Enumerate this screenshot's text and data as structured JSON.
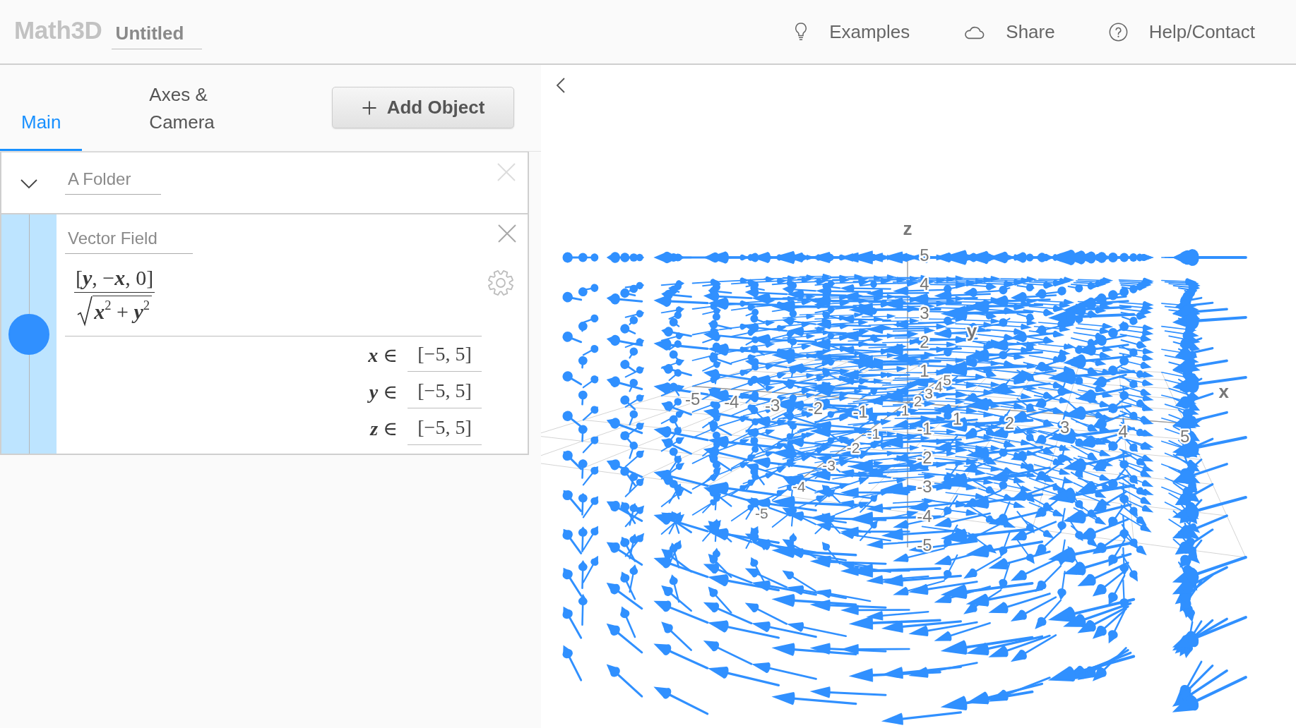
{
  "header": {
    "logo": "Math3D",
    "title": "Untitled",
    "links": [
      {
        "kind": "examples",
        "label": "Examples"
      },
      {
        "kind": "share",
        "label": "Share"
      },
      {
        "kind": "help",
        "label": "Help/Contact"
      }
    ]
  },
  "sidebar": {
    "tabs": [
      {
        "label": "Main",
        "selected": true
      },
      {
        "label": "Axes & Camera",
        "selected": false
      }
    ],
    "add_button": "Add Object",
    "objects": [
      {
        "kind": "folder",
        "name": "A Folder",
        "expanded": true,
        "children": [
          {
            "kind": "vector_field",
            "name": "Vector Field",
            "visible": true,
            "color": "#3090ff",
            "expression": {
              "numerator": "[**y**, −**x**, 0]",
              "radicand": "**x**$^{2}$ + **y**$^{2}$"
            },
            "domain": [
              {
                "label": "**x** ∈",
                "value": "[−5, 5]"
              },
              {
                "label": "**y** ∈",
                "value": "[−5, 5]"
              },
              {
                "label": "**z** ∈",
                "value": "[−5, 5]"
              }
            ]
          }
        ]
      }
    ]
  },
  "scene": {
    "axes": [
      {
        "label": "x",
        "ticks": [
          "-5",
          "-4",
          "-3",
          "-2",
          "-1",
          "1",
          "2",
          "3",
          "4",
          "5"
        ]
      },
      {
        "label": "y",
        "ticks": [
          "-5",
          "-4",
          "-3",
          "-2",
          "-1",
          "1",
          "2",
          "3",
          "4",
          "5"
        ]
      },
      {
        "label": "z",
        "ticks": [
          "5",
          "4",
          "3",
          "2",
          "1",
          "-1",
          "-2",
          "-3",
          "-4",
          "-5"
        ]
      }
    ]
  }
}
